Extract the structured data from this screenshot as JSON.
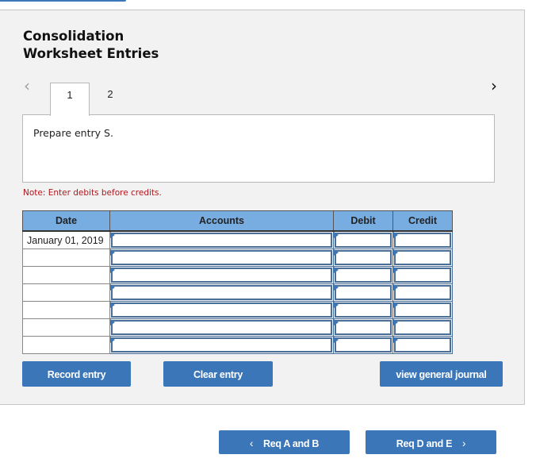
{
  "header": {
    "title_line1": "Consolidation",
    "title_line2": "Worksheet Entries"
  },
  "pager": {
    "prev_icon": "‹",
    "next_icon": "›",
    "tabs": [
      {
        "label": "1",
        "active": true
      },
      {
        "label": "2",
        "active": false
      }
    ]
  },
  "prompt": {
    "text": "Prepare entry S."
  },
  "note": "Note: Enter debits before credits.",
  "journal": {
    "columns": [
      "Date",
      "Accounts",
      "Debit",
      "Credit"
    ],
    "rows": [
      {
        "date": "January 01, 2019",
        "account": "",
        "debit": "",
        "credit": ""
      },
      {
        "date": "",
        "account": "",
        "debit": "",
        "credit": ""
      },
      {
        "date": "",
        "account": "",
        "debit": "",
        "credit": ""
      },
      {
        "date": "",
        "account": "",
        "debit": "",
        "credit": ""
      },
      {
        "date": "",
        "account": "",
        "debit": "",
        "credit": ""
      },
      {
        "date": "",
        "account": "",
        "debit": "",
        "credit": ""
      },
      {
        "date": "",
        "account": "",
        "debit": "",
        "credit": ""
      }
    ]
  },
  "buttons": {
    "record": "Record entry",
    "clear": "Clear entry",
    "view_journal": "view general journal",
    "prev_req": "Req A and B",
    "next_req": "Req D and E",
    "prev_chevron": "‹",
    "next_chevron": "›"
  },
  "colors": {
    "accent": "#3b76b9",
    "header_fill": "#78ade2",
    "note_red": "#b0171f"
  }
}
